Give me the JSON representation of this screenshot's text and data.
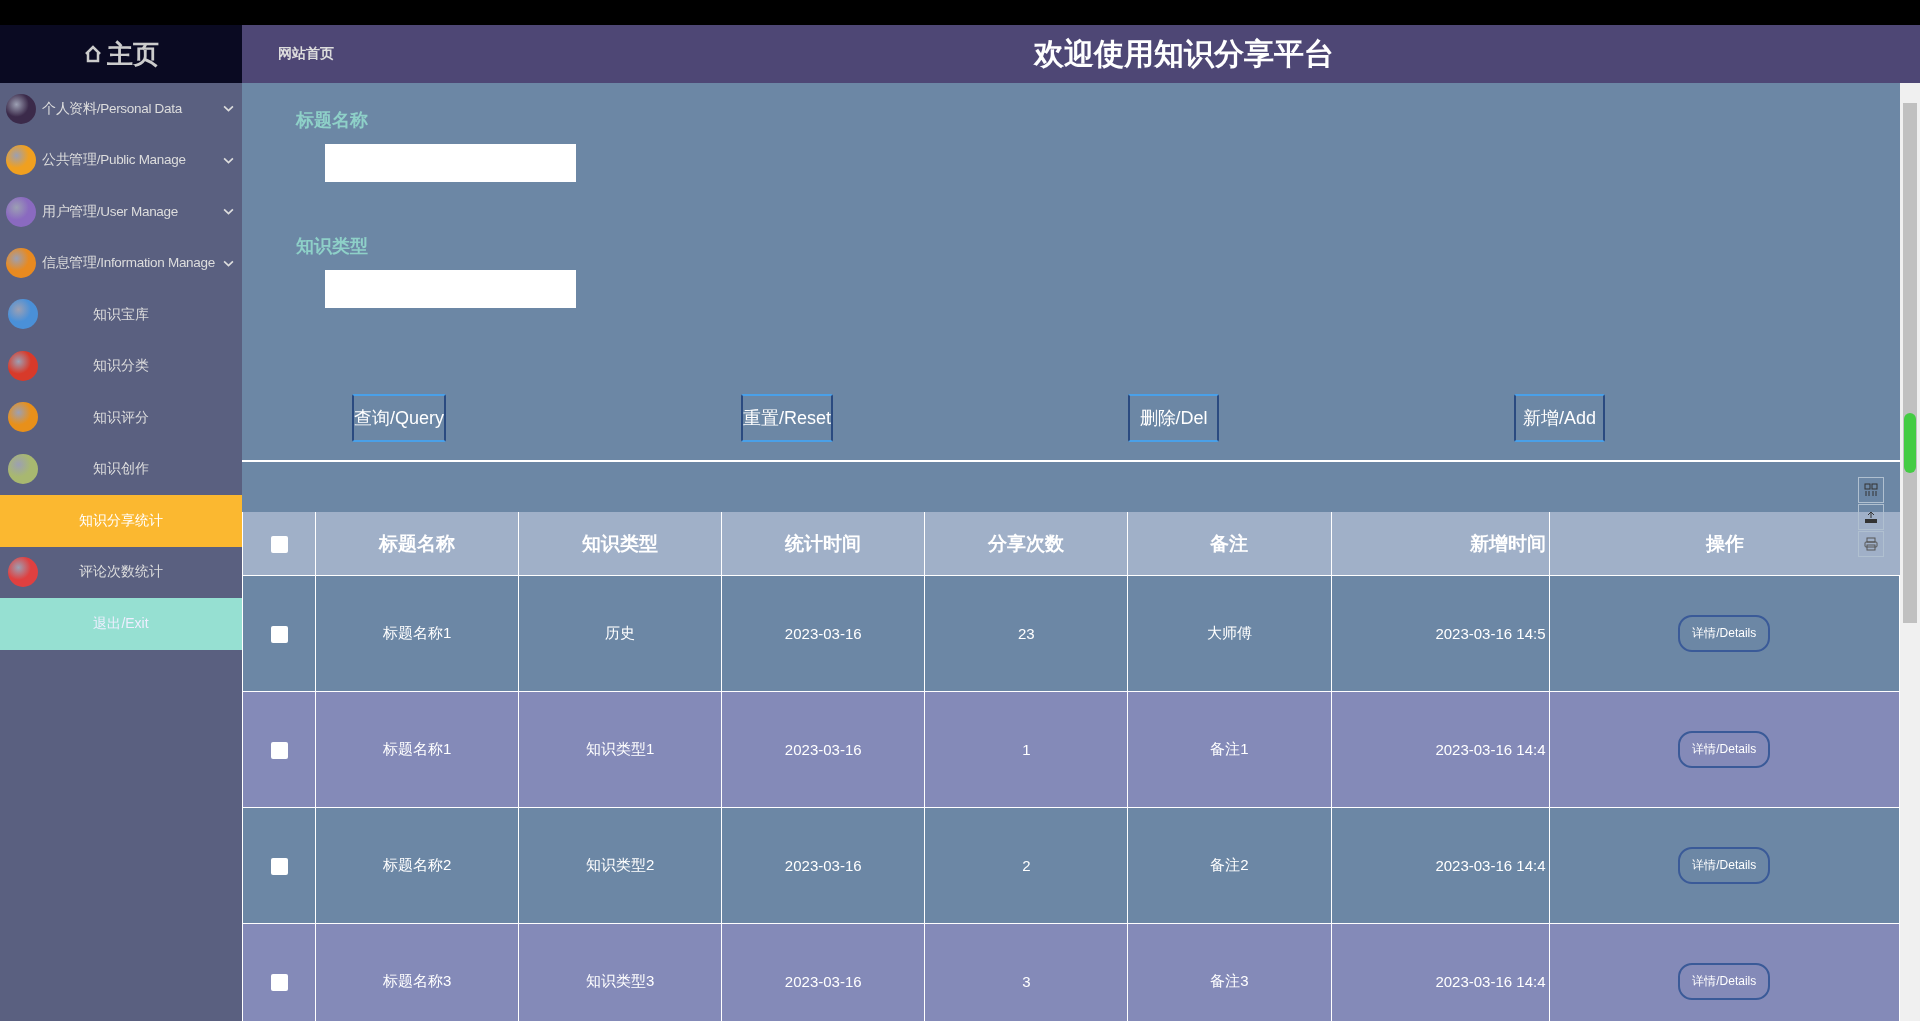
{
  "header": {
    "home_link": "网站首页",
    "title": "欢迎使用知识分享平台"
  },
  "sidebar": {
    "home": "主页",
    "items": [
      {
        "label": "个人资料/Personal Data",
        "kind": "group",
        "selected": false
      },
      {
        "label": "公共管理/Public Manage",
        "kind": "group",
        "selected": false
      },
      {
        "label": "用户管理/User Manage",
        "kind": "group",
        "selected": false
      },
      {
        "label": "信息管理/Information Manage",
        "kind": "group",
        "selected": false
      },
      {
        "label": "知识宝库",
        "kind": "link",
        "selected": false
      },
      {
        "label": "知识分类",
        "kind": "link",
        "selected": false
      },
      {
        "label": "知识评分",
        "kind": "link",
        "selected": false
      },
      {
        "label": "知识创作",
        "kind": "link",
        "selected": false
      },
      {
        "label": "知识分享统计",
        "kind": "link",
        "selected": true
      },
      {
        "label": "评论次数统计",
        "kind": "link",
        "selected": false
      },
      {
        "label": "退出/Exit",
        "kind": "exit",
        "selected": false
      }
    ]
  },
  "filters": [
    {
      "label": "标题名称"
    },
    {
      "label": "知识类型"
    }
  ],
  "buttons": [
    "查询/Query",
    "重置/Reset",
    "删除/Del",
    "新增/Add"
  ],
  "table": {
    "select_all_checked": false,
    "columns": [
      "标题名称",
      "知识类型",
      "统计时间",
      "分享次数",
      "备注",
      "新增时间",
      "操作"
    ],
    "rows": [
      {
        "checked": false,
        "cells": [
          "标题名称1",
          "历史",
          "2023-03-16",
          "23",
          "大师傅",
          "2023-03-16 14:5"
        ],
        "action": "详情/Details"
      },
      {
        "checked": false,
        "cells": [
          "标题名称1",
          "知识类型1",
          "2023-03-16",
          "1",
          "备注1",
          "2023-03-16 14:4"
        ],
        "action": "详情/Details"
      },
      {
        "checked": false,
        "cells": [
          "标题名称2",
          "知识类型2",
          "2023-03-16",
          "2",
          "备注2",
          "2023-03-16 14:4"
        ],
        "action": "详情/Details"
      },
      {
        "checked": false,
        "cells": [
          "标题名称3",
          "知识类型3",
          "2023-03-16",
          "3",
          "备注3",
          "2023-03-16 14:4"
        ],
        "action": "详情/Details"
      }
    ]
  }
}
